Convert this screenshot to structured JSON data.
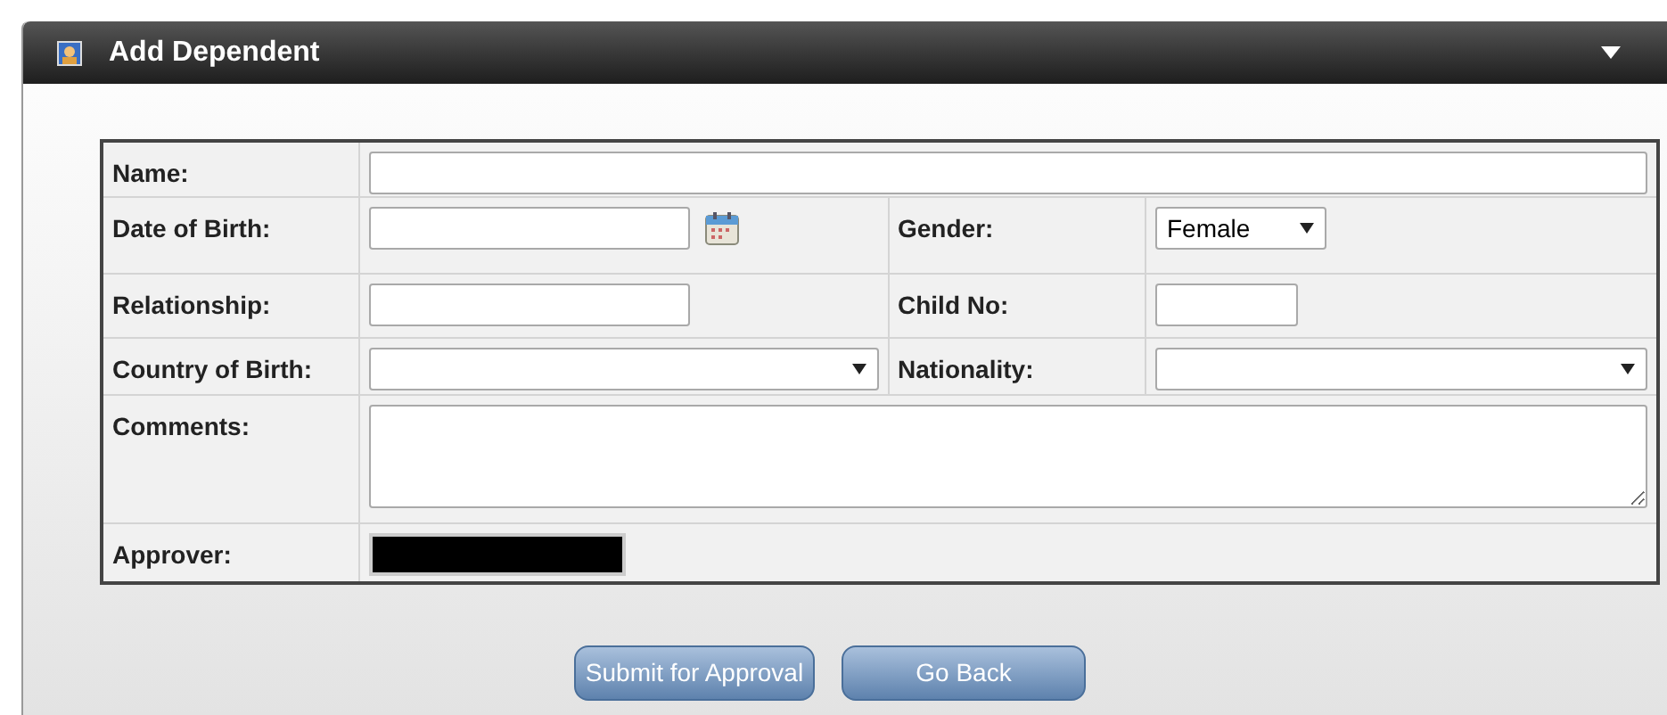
{
  "panel": {
    "title": "Add Dependent"
  },
  "form": {
    "rows": [
      {
        "fields": [
          {
            "label": "Name:",
            "kind": "text"
          }
        ]
      },
      {
        "fields": [
          {
            "label": "Date of Birth:",
            "kind": "date"
          },
          {
            "label": "Gender:",
            "kind": "select",
            "value": "Female"
          }
        ]
      },
      {
        "fields": [
          {
            "label": "Relationship:",
            "kind": "text"
          },
          {
            "label": "Child No:",
            "kind": "text"
          }
        ]
      },
      {
        "fields": [
          {
            "label": "Country of Birth:",
            "kind": "select"
          },
          {
            "label": "Nationality:",
            "kind": "select"
          }
        ]
      },
      {
        "fields": [
          {
            "label": "Comments:",
            "kind": "textarea"
          }
        ]
      },
      {
        "fields": [
          {
            "label": "Approver:",
            "kind": "redacted"
          }
        ]
      }
    ]
  },
  "buttons": [
    "Submit for Approval",
    "Go Back"
  ]
}
